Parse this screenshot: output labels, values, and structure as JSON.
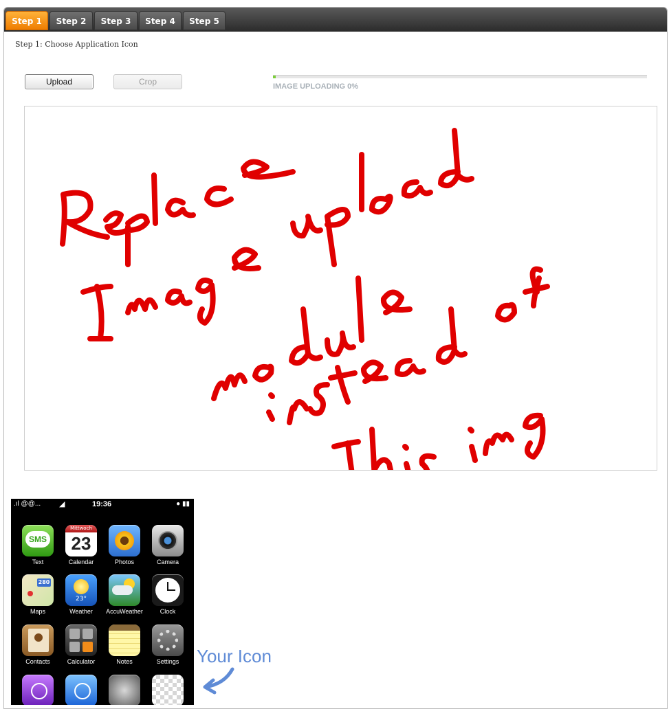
{
  "tabs": [
    {
      "label": "Step 1",
      "active": true
    },
    {
      "label": "Step 2",
      "active": false
    },
    {
      "label": "Step 3",
      "active": false
    },
    {
      "label": "Step 4",
      "active": false
    },
    {
      "label": "Step 5",
      "active": false
    }
  ],
  "step_title": "Step 1: Choose Application Icon",
  "buttons": {
    "upload": "Upload",
    "crop": "Crop"
  },
  "progress": {
    "value": 0,
    "label": "IMAGE UPLOADING 0%"
  },
  "annotation": {
    "handwritten": "Replace Image upload module instead of this img",
    "color": "#e00000"
  },
  "phone": {
    "status": {
      "signal": ".ıl @@...",
      "time": "19:36"
    },
    "apps": [
      {
        "label": "Text",
        "icon": "sms-icon",
        "text": "SMS"
      },
      {
        "label": "Calendar",
        "icon": "calendar-icon",
        "day": "Mittwoch",
        "date": "23"
      },
      {
        "label": "Photos",
        "icon": "photos-icon"
      },
      {
        "label": "Camera",
        "icon": "camera-icon"
      },
      {
        "label": "Maps",
        "icon": "maps-icon",
        "text": "280"
      },
      {
        "label": "Weather",
        "icon": "weather-icon",
        "text": "23°"
      },
      {
        "label": "AccuWeather",
        "icon": "accuweather-icon"
      },
      {
        "label": "Clock",
        "icon": "clock-icon"
      },
      {
        "label": "Contacts",
        "icon": "contacts-icon"
      },
      {
        "label": "Calculator",
        "icon": "calculator-icon"
      },
      {
        "label": "Notes",
        "icon": "notes-icon"
      },
      {
        "label": "Settings",
        "icon": "settings-icon"
      },
      {
        "label": "",
        "icon": "itunes-icon"
      },
      {
        "label": "",
        "icon": "app-store-icon"
      },
      {
        "label": "",
        "icon": "game-icon"
      },
      {
        "label": "",
        "icon": "placeholder-icon"
      }
    ]
  },
  "your_icon_label": "Your Icon"
}
